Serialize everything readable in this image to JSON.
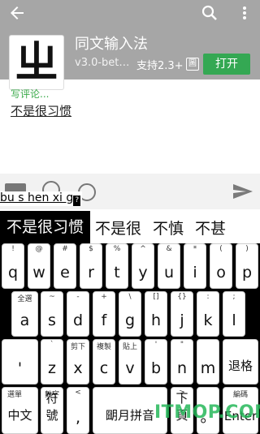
{
  "appbar": {
    "back_icon": "arrow-left-icon",
    "title": "同文输入法",
    "version": "v3.0-bet…",
    "support": "支持2.3+",
    "box_icon": "圖",
    "open_label": "打开",
    "logo_text": "ㄓ"
  },
  "comment": {
    "label": "写评论...",
    "text": "不是很习惯"
  },
  "input": {
    "pinyin": "bu s hen xi g",
    "cursor_glyph": "?"
  },
  "candidates": [
    "不是很习惯",
    "不是很",
    "不慎",
    "不甚"
  ],
  "keyboard": {
    "row1": [
      {
        "sup": "!",
        "main": "q"
      },
      {
        "sup": "@",
        "main": "w"
      },
      {
        "sup": "#",
        "main": "e"
      },
      {
        "sup": "$",
        "main": "r"
      },
      {
        "sup": "%",
        "main": "t"
      },
      {
        "sup": "^",
        "main": "y"
      },
      {
        "sup": "&",
        "main": "u"
      },
      {
        "sup": "*",
        "main": "i"
      },
      {
        "sup": "(",
        "main": "o"
      },
      {
        "sup": ")",
        "main": "p"
      }
    ],
    "row2": [
      {
        "sup": "全選",
        "main": "a"
      },
      {
        "sup": "~",
        "main": "s"
      },
      {
        "sup": "-",
        "main": "d"
      },
      {
        "sup": "+",
        "main": "f"
      },
      {
        "sup": "\\",
        "main": "g"
      },
      {
        "sup": "[]",
        "main": "h"
      },
      {
        "sup": "{}",
        "main": "j"
      },
      {
        "sup": ":",
        "main": "k"
      },
      {
        "sup": ";",
        "main": "l"
      }
    ],
    "row3": [
      {
        "sup": "",
        "main": "'"
      },
      {
        "sup": "`",
        "main": "z"
      },
      {
        "sup": "剪下",
        "main": "x"
      },
      {
        "sup": "複製",
        "main": "c"
      },
      {
        "sup": "貼上",
        "main": "v"
      },
      {
        "sup": "'",
        "main": "b"
      },
      {
        "sup": "\"",
        "main": "n"
      },
      {
        "sup": "",
        "main": "m"
      },
      {
        "sup": "",
        "main": "退格"
      }
    ],
    "row4": [
      {
        "sup": "選單",
        "main": "中文"
      },
      {
        "sup": "數字",
        "main": "符號"
      },
      {
        "sup": "<",
        "main": ","
      },
      {
        "sup": "",
        "main": "朙月拼音"
      },
      {
        "sup": ">",
        "main": "下頁"
      },
      {
        "sup": "",
        "main": "。"
      },
      {
        "sup": "編碼",
        "main": "Enter"
      }
    ]
  },
  "watermark": "ITMOP.COM"
}
